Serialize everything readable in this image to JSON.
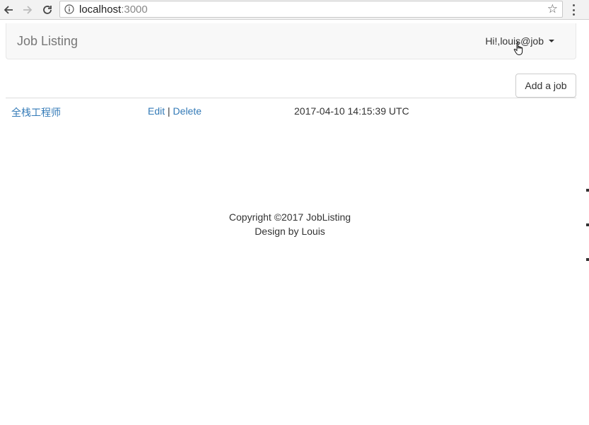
{
  "browser": {
    "url_host": "localhost",
    "url_port": ":3000"
  },
  "navbar": {
    "brand": "Job Listing",
    "user_greeting": "Hi!,louis@job"
  },
  "toolbar": {
    "add_job_label": "Add a job"
  },
  "jobs": [
    {
      "title": "全栈工程师",
      "edit_label": "Edit",
      "separator": "|",
      "delete_label": "Delete",
      "created_at": "2017-04-10 14:15:39 UTC"
    }
  ],
  "footer": {
    "copyright": "Copyright ©2017 JobListing",
    "credit": "Design by Louis"
  },
  "colors": {
    "link": "#337ab7",
    "navbar_bg": "#f8f8f8",
    "brand_text": "#777777"
  },
  "icons": [
    "back-arrow-icon",
    "forward-arrow-icon",
    "reload-icon",
    "info-icon",
    "star-icon",
    "menu-dots-icon",
    "caret-down-icon",
    "hand-cursor-icon"
  ]
}
